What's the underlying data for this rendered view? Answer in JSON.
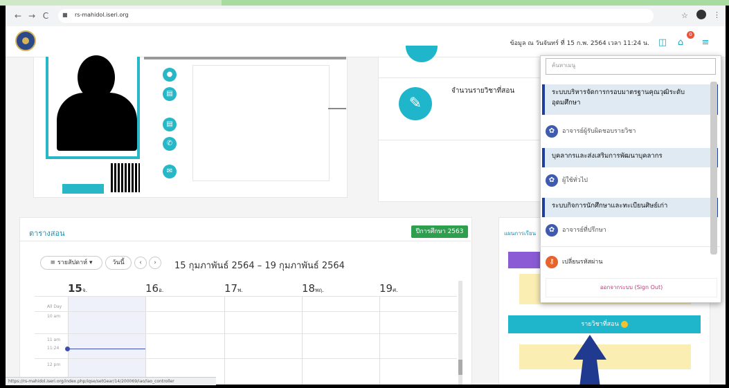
{
  "browser": {
    "url": "rs-mahidol.iseri.org",
    "nav": {
      "back": "←",
      "forward": "→",
      "reload": "C"
    },
    "status_url": "https://rs-mahidol.iseri.org/index.php/iqse/setGear/14/200069/iao/lao_controller"
  },
  "header": {
    "info_text": "ข้อมูล ณ วันจันทร์ ที่ 15 ก.พ. 2564 เวลา 11:24 น.",
    "notification_count": "0"
  },
  "stats": {
    "subjects_taught_label": "จำนวนรายวิชาที่สอน"
  },
  "schedule": {
    "title": "ตารางสอน",
    "academic_year_badge": "ปีการศึกษา 2563",
    "view_select": "≡ รายสัปดาห์ ▾",
    "today_button": "วันนี้",
    "prev": "‹",
    "next": "›",
    "date_range": "15 กุมภาพันธ์ 2564 – 19 กุมภาพันธ์ 2564",
    "days": [
      {
        "num": "15",
        "abbr": "จ."
      },
      {
        "num": "16",
        "abbr": "อ."
      },
      {
        "num": "17",
        "abbr": "พ."
      },
      {
        "num": "18",
        "abbr": "พฤ."
      },
      {
        "num": "19",
        "abbr": "ศ."
      }
    ],
    "time_labels": {
      "allday": "All Day",
      "t10": "10 am",
      "t11": "11 am",
      "now": "11:24",
      "t12": "12 pm"
    }
  },
  "right_panel": {
    "title": "แผนการเรียน",
    "subjects_button": "รายวิชาที่สอน"
  },
  "dropdown": {
    "search_placeholder": "ค้นหาเมนู",
    "sections": [
      {
        "header": "ระบบบริหารจัดการกรอบมาตรฐานคุณวุฒิระดับอุดมศึกษา",
        "items": [
          "อาจารย์ผู้รับผิดชอบรายวิชา"
        ]
      },
      {
        "header": "บุคลากรและส่งเสริมการพัฒนาบุคลากร",
        "items": [
          "ผู้ใช้ทั่วไป"
        ]
      },
      {
        "header": "ระบบกิจการนักศึกษาและทะเบียนศิษย์เก่า",
        "items": [
          "อาจารย์ที่ปรึกษา"
        ]
      }
    ],
    "change_password": "เปลี่ยนรหัสผ่าน",
    "sign_out": "ออกจากระบบ (Sign Out)"
  }
}
